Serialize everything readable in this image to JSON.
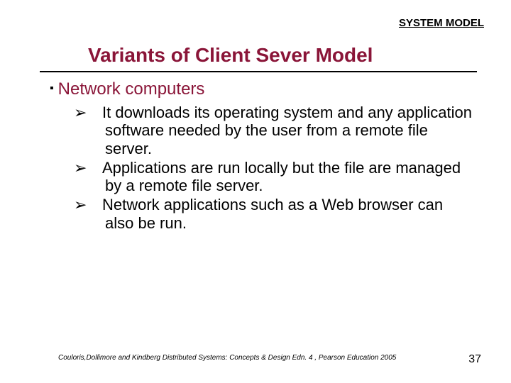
{
  "header": {
    "label": "SYSTEM MODEL"
  },
  "title": "Variants of Client Sever Model",
  "section": {
    "heading": "Network computers",
    "bullets": [
      "It downloads its operating system and any application software needed by the user from a remote file server.",
      "Applications are run locally but the file are managed by a remote file server.",
      "Network applications such as a Web browser can also be run."
    ]
  },
  "footer": "Couloris,Dollimore and Kindberg  Distributed Systems: Concepts & Design  Edn. 4 , Pearson Education 2005",
  "page_number": "37",
  "glyphs": {
    "square": "▪",
    "arrow": "➢"
  }
}
